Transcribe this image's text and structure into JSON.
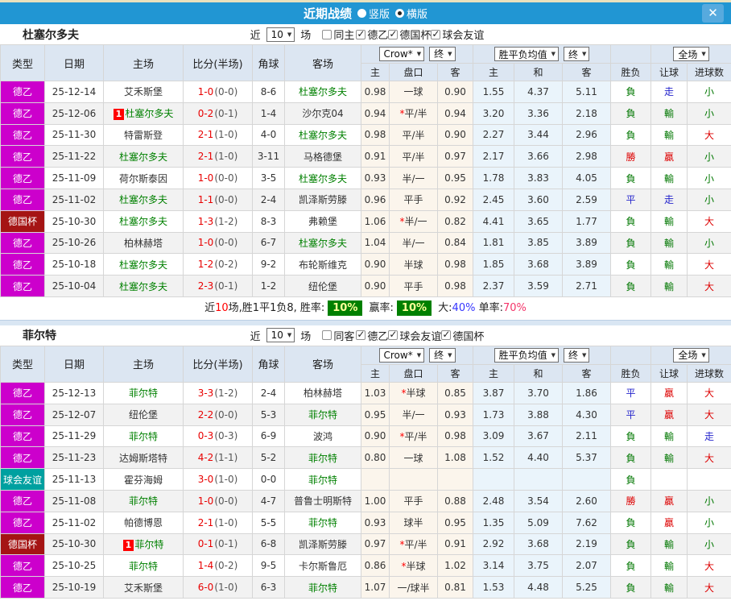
{
  "window": {
    "title": "近期战绩",
    "view_options": [
      {
        "label": "竖版",
        "selected": false
      },
      {
        "label": "横版",
        "selected": true
      }
    ],
    "close_label": "✕"
  },
  "columns": {
    "main": [
      "类型",
      "日期",
      "主场",
      "比分(半场)",
      "角球",
      "客场"
    ],
    "sub": [
      "主",
      "盘口",
      "客",
      "主",
      "和",
      "客",
      "胜负",
      "让球",
      "进球数"
    ],
    "odds_source_label": "Crow*",
    "final_label": "终",
    "avg_label": "胜平负均值",
    "scope_label": "全场"
  },
  "colors": {
    "titlebar": "#2196d3",
    "league": {
      "德乙": "#cc00cc",
      "德国杯": "#a51414",
      "球会友谊": "#00a0a0"
    },
    "outcome": {
      "勝": "#dd0000",
      "贏": "#dd0000",
      "大": "#dd0000",
      "平": "#2525cc",
      "走": "#2525cc",
      "負": "#007700",
      "輸": "#007700",
      "小": "#007700"
    },
    "team_highlight": "#008000",
    "score_red": "#e80000"
  },
  "sections": [
    {
      "team": "杜塞尔多夫",
      "filter": {
        "near": "近",
        "count": "10",
        "matches": "场",
        "same": {
          "label": "同主",
          "checked": false
        },
        "leagues": [
          {
            "label": "德乙",
            "checked": true
          },
          {
            "label": "德国杯",
            "checked": true
          },
          {
            "label": "球会友谊",
            "checked": true
          }
        ]
      },
      "rows": [
        {
          "league": "德乙",
          "date": "25-12-14",
          "home": "艾禾斯堡",
          "home_hl": false,
          "home_badge": false,
          "score": "1-0",
          "half": "(0-0)",
          "corners": "8-6",
          "away": "杜塞尔多夫",
          "away_hl": true,
          "oh": "0.98",
          "hc": "一球",
          "hc_star": false,
          "oa": "0.90",
          "ah": "1.55",
          "ad": "4.37",
          "aa": "5.11",
          "res": "負",
          "hres": "走",
          "goal": "小"
        },
        {
          "league": "德乙",
          "date": "25-12-06",
          "home": "杜塞尔多夫",
          "home_hl": true,
          "home_badge": true,
          "score": "0-2",
          "half": "(0-1)",
          "corners": "1-4",
          "away": "沙尔克04",
          "away_hl": false,
          "oh": "0.94",
          "hc": "平/半",
          "hc_star": true,
          "oa": "0.94",
          "ah": "3.20",
          "ad": "3.36",
          "aa": "2.18",
          "res": "負",
          "hres": "輸",
          "goal": "小"
        },
        {
          "league": "德乙",
          "date": "25-11-30",
          "home": "特雷斯登",
          "home_hl": false,
          "home_badge": false,
          "score": "2-1",
          "half": "(1-0)",
          "corners": "4-0",
          "away": "杜塞尔多夫",
          "away_hl": true,
          "oh": "0.98",
          "hc": "平/半",
          "hc_star": false,
          "oa": "0.90",
          "ah": "2.27",
          "ad": "3.44",
          "aa": "2.96",
          "res": "負",
          "hres": "輸",
          "goal": "大"
        },
        {
          "league": "德乙",
          "date": "25-11-22",
          "home": "杜塞尔多夫",
          "home_hl": true,
          "home_badge": false,
          "score": "2-1",
          "half": "(1-0)",
          "corners": "3-11",
          "away": "马格德堡",
          "away_hl": false,
          "oh": "0.91",
          "hc": "平/半",
          "hc_star": false,
          "oa": "0.97",
          "ah": "2.17",
          "ad": "3.66",
          "aa": "2.98",
          "res": "勝",
          "hres": "贏",
          "goal": "小"
        },
        {
          "league": "德乙",
          "date": "25-11-09",
          "home": "荷尔斯泰因",
          "home_hl": false,
          "home_badge": false,
          "score": "1-0",
          "half": "(0-0)",
          "corners": "3-5",
          "away": "杜塞尔多夫",
          "away_hl": true,
          "oh": "0.93",
          "hc": "半/一",
          "hc_star": false,
          "oa": "0.95",
          "ah": "1.78",
          "ad": "3.83",
          "aa": "4.05",
          "res": "負",
          "hres": "輸",
          "goal": "小"
        },
        {
          "league": "德乙",
          "date": "25-11-02",
          "home": "杜塞尔多夫",
          "home_hl": true,
          "home_badge": false,
          "score": "1-1",
          "half": "(0-0)",
          "corners": "2-4",
          "away": "凯泽斯劳滕",
          "away_hl": false,
          "oh": "0.96",
          "hc": "平手",
          "hc_star": false,
          "oa": "0.92",
          "ah": "2.45",
          "ad": "3.60",
          "aa": "2.59",
          "res": "平",
          "hres": "走",
          "goal": "小"
        },
        {
          "league": "德国杯",
          "date": "25-10-30",
          "home": "杜塞尔多夫",
          "home_hl": true,
          "home_badge": false,
          "score": "1-3",
          "half": "(1-2)",
          "corners": "8-3",
          "away": "弗赖堡",
          "away_hl": false,
          "oh": "1.06",
          "hc": "半/一",
          "hc_star": true,
          "oa": "0.82",
          "ah": "4.41",
          "ad": "3.65",
          "aa": "1.77",
          "res": "負",
          "hres": "輸",
          "goal": "大"
        },
        {
          "league": "德乙",
          "date": "25-10-26",
          "home": "柏林赫塔",
          "home_hl": false,
          "home_badge": false,
          "score": "1-0",
          "half": "(0-0)",
          "corners": "6-7",
          "away": "杜塞尔多夫",
          "away_hl": true,
          "oh": "1.04",
          "hc": "半/一",
          "hc_star": false,
          "oa": "0.84",
          "ah": "1.81",
          "ad": "3.85",
          "aa": "3.89",
          "res": "負",
          "hres": "輸",
          "goal": "小"
        },
        {
          "league": "德乙",
          "date": "25-10-18",
          "home": "杜塞尔多夫",
          "home_hl": true,
          "home_badge": false,
          "score": "1-2",
          "half": "(0-2)",
          "corners": "9-2",
          "away": "布轮斯维克",
          "away_hl": false,
          "oh": "0.90",
          "hc": "半球",
          "hc_star": false,
          "oa": "0.98",
          "ah": "1.85",
          "ad": "3.68",
          "aa": "3.89",
          "res": "負",
          "hres": "輸",
          "goal": "大"
        },
        {
          "league": "德乙",
          "date": "25-10-04",
          "home": "杜塞尔多夫",
          "home_hl": true,
          "home_badge": false,
          "score": "2-3",
          "half": "(0-1)",
          "corners": "1-2",
          "away": "纽伦堡",
          "away_hl": false,
          "oh": "0.90",
          "hc": "平手",
          "hc_star": false,
          "oa": "0.98",
          "ah": "2.37",
          "ad": "3.59",
          "aa": "2.71",
          "res": "負",
          "hres": "輸",
          "goal": "大"
        }
      ],
      "summary": [
        {
          "t": "近",
          "c": "plain"
        },
        {
          "t": "10",
          "c": "red"
        },
        {
          "t": "场,胜1平1负8, 胜率:",
          "c": "plain"
        },
        {
          "t": "10%",
          "c": "badge"
        },
        {
          "t": " 赢率:",
          "c": "plain"
        },
        {
          "t": "10%",
          "c": "badge"
        },
        {
          "t": " 大:",
          "c": "plain"
        },
        {
          "t": "40%",
          "c": "blue"
        },
        {
          "t": " 单率:",
          "c": "plain"
        },
        {
          "t": "70%",
          "c": "pink"
        }
      ]
    },
    {
      "team": "菲尔特",
      "filter": {
        "near": "近",
        "count": "10",
        "matches": "场",
        "same": {
          "label": "同客",
          "checked": false
        },
        "leagues": [
          {
            "label": "德乙",
            "checked": true
          },
          {
            "label": "球会友谊",
            "checked": true
          },
          {
            "label": "德国杯",
            "checked": true
          }
        ]
      },
      "rows": [
        {
          "league": "德乙",
          "date": "25-12-13",
          "home": "菲尔特",
          "home_hl": true,
          "home_badge": false,
          "score": "3-3",
          "half": "(1-2)",
          "corners": "2-4",
          "away": "柏林赫塔",
          "away_hl": false,
          "oh": "1.03",
          "hc": "半球",
          "hc_star": true,
          "oa": "0.85",
          "ah": "3.87",
          "ad": "3.70",
          "aa": "1.86",
          "res": "平",
          "hres": "贏",
          "goal": "大"
        },
        {
          "league": "德乙",
          "date": "25-12-07",
          "home": "纽伦堡",
          "home_hl": false,
          "home_badge": false,
          "score": "2-2",
          "half": "(0-0)",
          "corners": "5-3",
          "away": "菲尔特",
          "away_hl": true,
          "oh": "0.95",
          "hc": "半/一",
          "hc_star": false,
          "oa": "0.93",
          "ah": "1.73",
          "ad": "3.88",
          "aa": "4.30",
          "res": "平",
          "hres": "贏",
          "goal": "大"
        },
        {
          "league": "德乙",
          "date": "25-11-29",
          "home": "菲尔特",
          "home_hl": true,
          "home_badge": false,
          "score": "0-3",
          "half": "(0-3)",
          "corners": "6-9",
          "away": "波鸿",
          "away_hl": false,
          "oh": "0.90",
          "hc": "平/半",
          "hc_star": true,
          "oa": "0.98",
          "ah": "3.09",
          "ad": "3.67",
          "aa": "2.11",
          "res": "負",
          "hres": "輸",
          "goal": "走"
        },
        {
          "league": "德乙",
          "date": "25-11-23",
          "home": "达姆斯塔特",
          "home_hl": false,
          "home_badge": false,
          "score": "4-2",
          "half": "(1-1)",
          "corners": "5-2",
          "away": "菲尔特",
          "away_hl": true,
          "oh": "0.80",
          "hc": "一球",
          "hc_star": false,
          "oa": "1.08",
          "ah": "1.52",
          "ad": "4.40",
          "aa": "5.37",
          "res": "負",
          "hres": "輸",
          "goal": "大"
        },
        {
          "league": "球会友谊",
          "date": "25-11-13",
          "home": "霍芬海姆",
          "home_hl": false,
          "home_badge": false,
          "score": "3-0",
          "half": "(1-0)",
          "corners": "0-0",
          "away": "菲尔特",
          "away_hl": true,
          "oh": "",
          "hc": "",
          "hc_star": false,
          "oa": "",
          "ah": "",
          "ad": "",
          "aa": "",
          "res": "負",
          "hres": "",
          "goal": ""
        },
        {
          "league": "德乙",
          "date": "25-11-08",
          "home": "菲尔特",
          "home_hl": true,
          "home_badge": false,
          "score": "1-0",
          "half": "(0-0)",
          "corners": "4-7",
          "away": "普鲁士明斯特",
          "away_hl": false,
          "oh": "1.00",
          "hc": "平手",
          "hc_star": false,
          "oa": "0.88",
          "ah": "2.48",
          "ad": "3.54",
          "aa": "2.60",
          "res": "勝",
          "hres": "贏",
          "goal": "小"
        },
        {
          "league": "德乙",
          "date": "25-11-02",
          "home": "帕德博恩",
          "home_hl": false,
          "home_badge": false,
          "score": "2-1",
          "half": "(1-0)",
          "corners": "5-5",
          "away": "菲尔特",
          "away_hl": true,
          "oh": "0.93",
          "hc": "球半",
          "hc_star": false,
          "oa": "0.95",
          "ah": "1.35",
          "ad": "5.09",
          "aa": "7.62",
          "res": "負",
          "hres": "贏",
          "goal": "小"
        },
        {
          "league": "德国杯",
          "date": "25-10-30",
          "home": "菲尔特",
          "home_hl": true,
          "home_badge": true,
          "score": "0-1",
          "half": "(0-1)",
          "corners": "6-8",
          "away": "凯泽斯劳滕",
          "away_hl": false,
          "oh": "0.97",
          "hc": "平/半",
          "hc_star": true,
          "oa": "0.91",
          "ah": "2.92",
          "ad": "3.68",
          "aa": "2.19",
          "res": "負",
          "hres": "輸",
          "goal": "小"
        },
        {
          "league": "德乙",
          "date": "25-10-25",
          "home": "菲尔特",
          "home_hl": true,
          "home_badge": false,
          "score": "1-4",
          "half": "(0-2)",
          "corners": "9-5",
          "away": "卡尔斯鲁厄",
          "away_hl": false,
          "oh": "0.86",
          "hc": "半球",
          "hc_star": true,
          "oa": "1.02",
          "ah": "3.14",
          "ad": "3.75",
          "aa": "2.07",
          "res": "負",
          "hres": "輸",
          "goal": "大"
        },
        {
          "league": "德乙",
          "date": "25-10-19",
          "home": "艾禾斯堡",
          "home_hl": false,
          "home_badge": false,
          "score": "6-0",
          "half": "(1-0)",
          "corners": "6-3",
          "away": "菲尔特",
          "away_hl": true,
          "oh": "1.07",
          "hc": "一/球半",
          "hc_star": false,
          "oa": "0.81",
          "ah": "1.53",
          "ad": "4.48",
          "aa": "5.25",
          "res": "負",
          "hres": "輸",
          "goal": "大"
        }
      ],
      "summary": null
    }
  ]
}
